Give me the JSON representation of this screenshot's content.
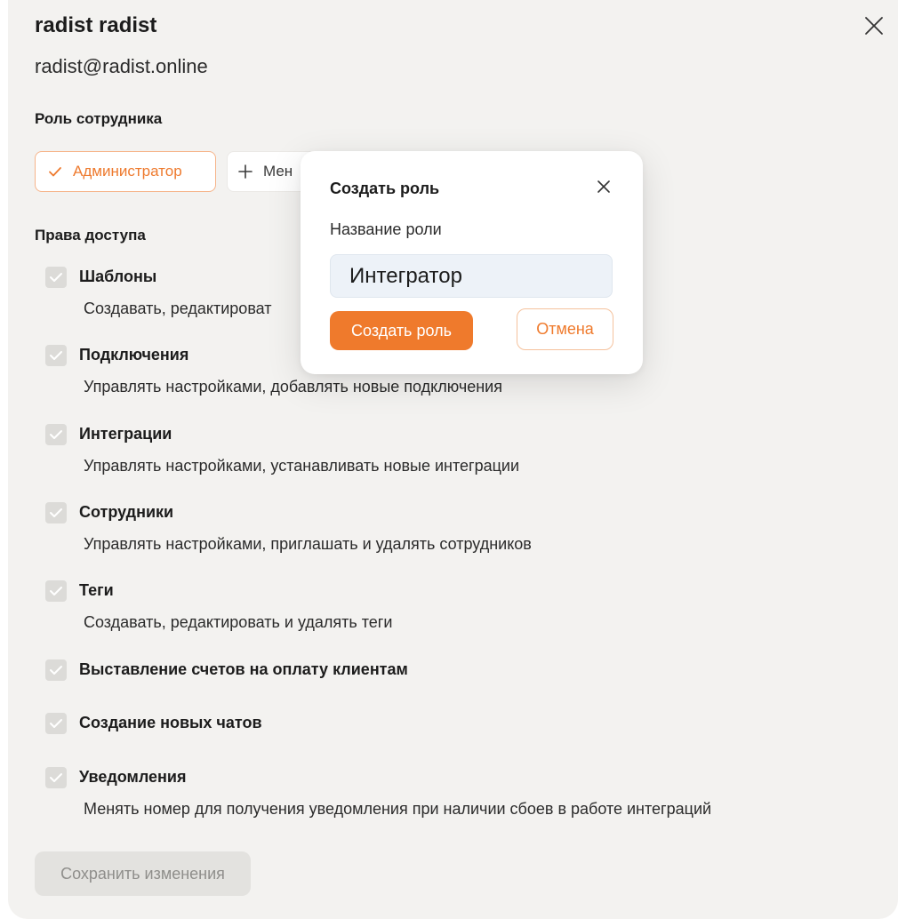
{
  "user": {
    "name": "radist radist",
    "email": "radist@radist.online"
  },
  "role_section": {
    "title": "Роль сотрудника",
    "roles": [
      {
        "label": "Администратор",
        "icon": "check-icon",
        "selected": true
      },
      {
        "label": "Мен",
        "icon": "plus-icon",
        "selected": false
      }
    ]
  },
  "permissions_section": {
    "title": "Права доступа",
    "items": [
      {
        "title": "Шаблоны",
        "description": "Создавать, редактироват",
        "checked": true
      },
      {
        "title": "Подключения",
        "description": "Управлять настройками, добавлять новые подключения",
        "checked": true
      },
      {
        "title": "Интеграции",
        "description": "Управлять настройками, устанавливать новые интеграции",
        "checked": true
      },
      {
        "title": "Сотрудники",
        "description": "Управлять настройками, приглашать и удалять сотрудников",
        "checked": true
      },
      {
        "title": "Теги",
        "description": "Создавать, редактировать и удалять теги",
        "checked": true
      },
      {
        "title": "Выставление счетов на оплату клиентам",
        "description": "",
        "checked": true
      },
      {
        "title": "Создание новых чатов",
        "description": "",
        "checked": true
      },
      {
        "title": "Уведомления",
        "description": "Менять номер для получения уведомления при наличии сбоев в работе интеграций",
        "checked": true
      }
    ]
  },
  "save_button": {
    "label": "Сохранить изменения"
  },
  "modal": {
    "title": "Создать роль",
    "field_label": "Название роли",
    "field_value": "Интегратор",
    "create_label": "Создать роль",
    "cancel_label": "Отмена"
  },
  "colors": {
    "accent": "#ef7a2c",
    "panel_bg": "#f3f2f0",
    "checkbox_bg": "#dcdbd8",
    "input_bg": "#edf2f8"
  }
}
